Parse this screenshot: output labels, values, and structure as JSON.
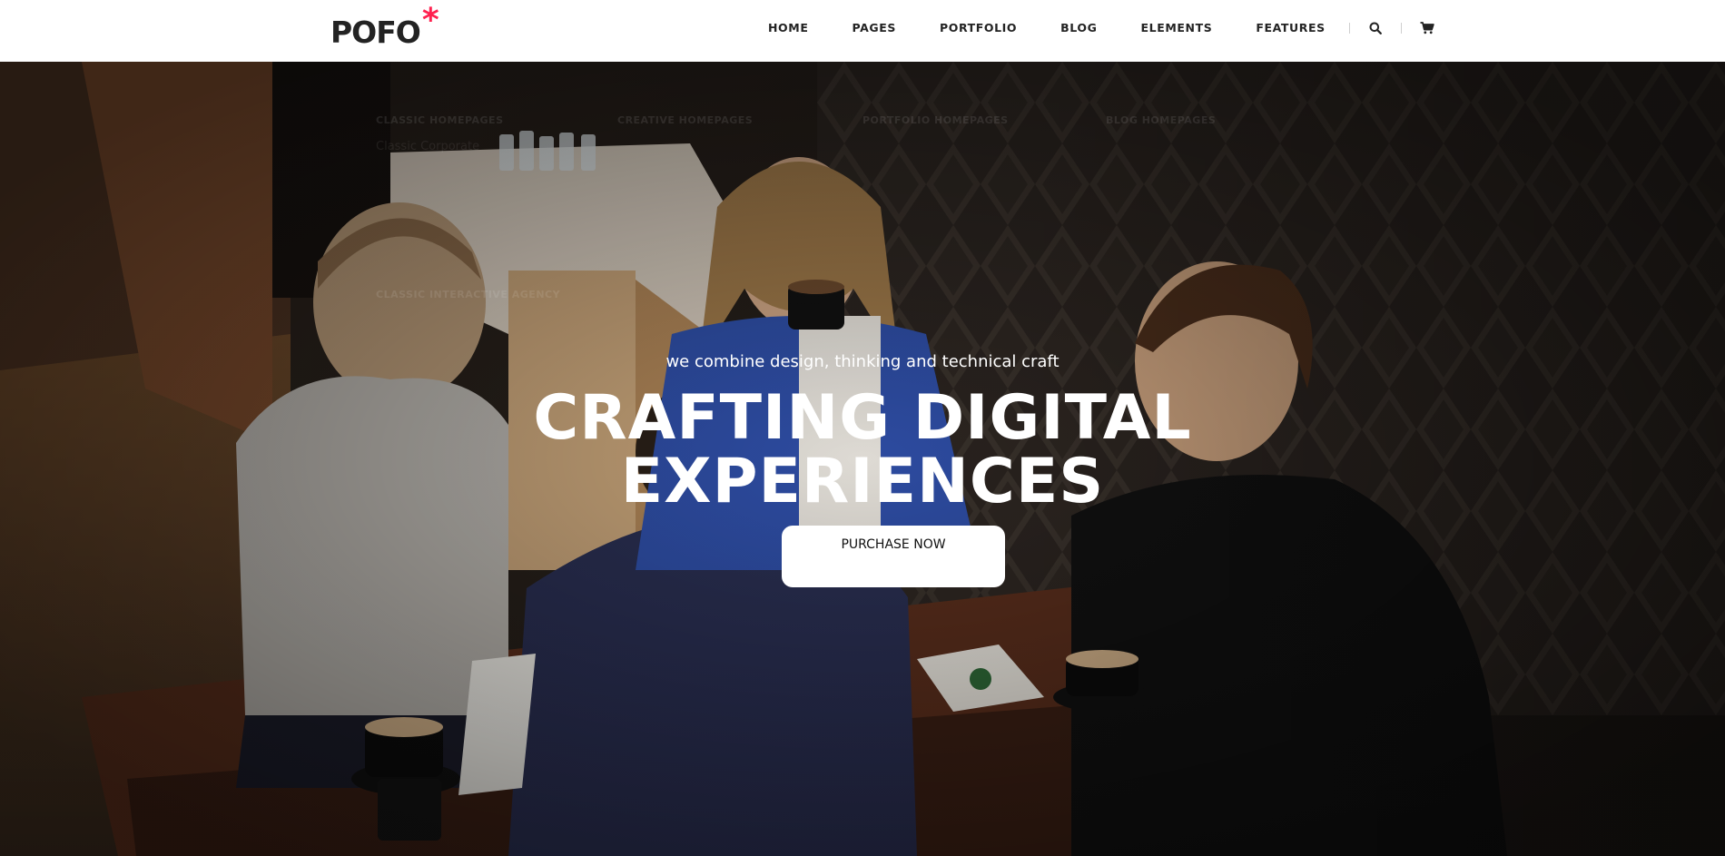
{
  "brand": {
    "logo_text": "POFO",
    "logo_mark": "*",
    "accent_color": "#ff214f"
  },
  "nav": {
    "items": [
      {
        "label": "HOME"
      },
      {
        "label": "PAGES"
      },
      {
        "label": "PORTFOLIO"
      },
      {
        "label": "BLOG"
      },
      {
        "label": "ELEMENTS"
      },
      {
        "label": "FEATURES"
      }
    ],
    "search_icon": "search-icon",
    "cart_icon": "cart-icon"
  },
  "mega_menu_ghost": {
    "col1": "CLASSIC HOMEPAGES",
    "col1_sub": "Classic Corporate",
    "col2": "CREATIVE HOMEPAGES",
    "col3": "PORTFOLIO HOMEPAGES",
    "col4": "BLOG HOMEPAGES",
    "col1_b": "CLASSIC INTERACTIVE AGENCY"
  },
  "hero": {
    "tagline": "we combine design, thinking and technical craft",
    "headline_line1": "CRAFTING DIGITAL",
    "headline_line2": "EXPERIENCES",
    "cta_label": "PURCHASE NOW"
  }
}
